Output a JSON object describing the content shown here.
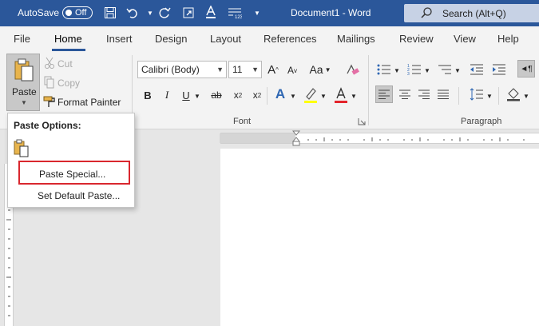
{
  "titlebar": {
    "autosave_label": "AutoSave",
    "autosave_state": "Off",
    "document_title": "Document1  -  Word",
    "search_placeholder": "Search (Alt+Q)"
  },
  "tabs": [
    "File",
    "Home",
    "Insert",
    "Design",
    "Layout",
    "References",
    "Mailings",
    "Review",
    "View",
    "Help"
  ],
  "active_tab": "Home",
  "clipboard": {
    "paste_label": "Paste",
    "cut_label": "Cut",
    "copy_label": "Copy",
    "format_painter_label": "Format Painter"
  },
  "font": {
    "group_label": "Font",
    "font_name": "Calibri (Body)",
    "font_size": "11"
  },
  "paragraph": {
    "group_label": "Paragraph"
  },
  "paste_menu": {
    "title": "Paste Options:",
    "paste_special": "Paste Special...",
    "set_default": "Set Default Paste..."
  },
  "colors": {
    "accent": "#2b579a",
    "highlight_border": "#d9272e",
    "font_color_bar": "#e3242b",
    "highlight_color_bar": "#ffff00"
  }
}
